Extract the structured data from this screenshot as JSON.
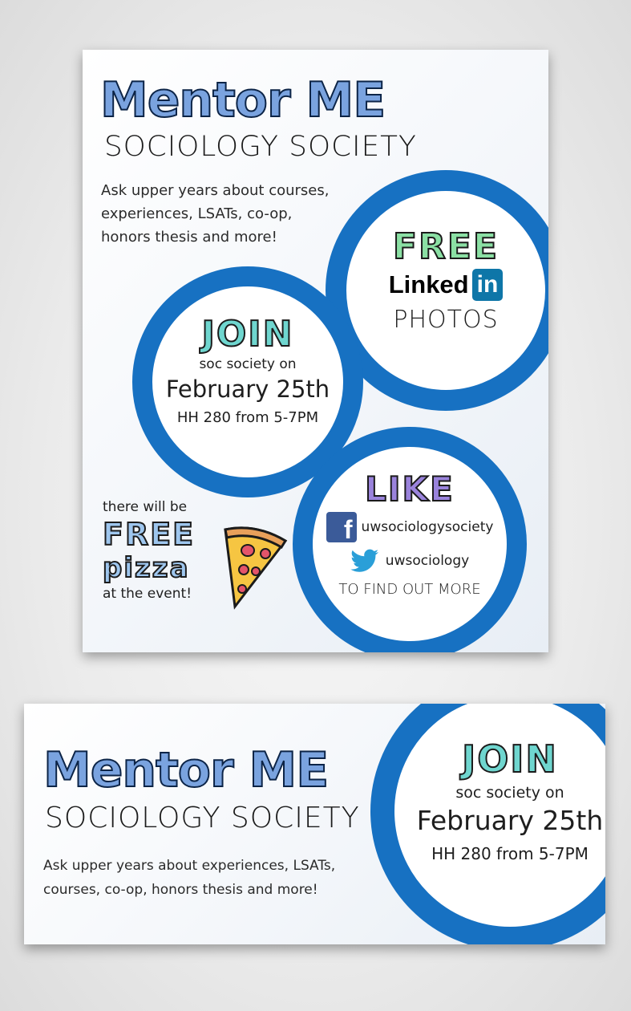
{
  "poster": {
    "title": "Mentor ME",
    "subtitle": "SOCIOLOGY SOCIETY",
    "blurb_lines": [
      "Ask upper years about courses,",
      "experiences, LSATs, co-op,",
      "honors thesis and more!"
    ],
    "linkedin_circle": {
      "headline": "FREE",
      "logo_word": "Linked",
      "logo_box": "in",
      "caption": "PHOTOS"
    },
    "join_circle": {
      "headline": "JOIN",
      "line1": "soc society on",
      "date": "February 25th",
      "location": "HH 280 from 5-7PM"
    },
    "like_circle": {
      "headline": "LIKE",
      "facebook_handle": "uwsociologysociety",
      "twitter_handle": "uwsociology",
      "footer": "TO FIND OUT MORE"
    },
    "pizza": {
      "line1": "there will be",
      "word1": "FREE",
      "word2": "pizza",
      "line2": "at the event!"
    }
  },
  "banner": {
    "title": "Mentor ME",
    "subtitle": "SOCIOLOGY SOCIETY",
    "blurb_lines": [
      "Ask upper years about experiences, LSATs,",
      "courses, co-op, honors thesis and more!"
    ],
    "join_circle": {
      "headline": "JOIN",
      "line1": "soc society on",
      "date": "February 25th",
      "location": "HH 280 from 5-7PM"
    }
  },
  "colors": {
    "circle_ring": "#1771c2",
    "title_fill": "#7aa3df",
    "free_green": "#8be0a4",
    "join_teal": "#6fd6cf",
    "like_purple": "#9a83dc",
    "pizza_blue": "#9ec6ee"
  },
  "icons": [
    "linkedin-logo",
    "facebook-icon",
    "twitter-icon",
    "pizza-slice-icon"
  ]
}
